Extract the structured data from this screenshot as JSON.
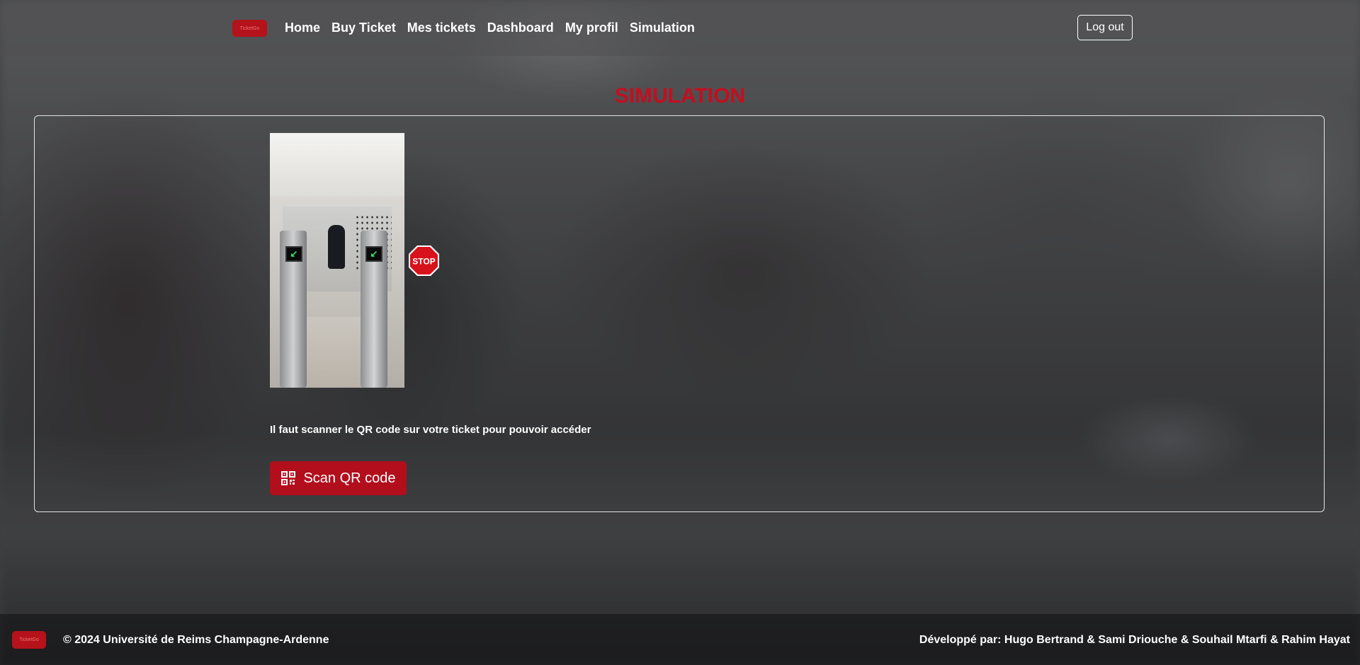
{
  "header": {
    "logo_text": "TicketGo",
    "nav": [
      {
        "label": "Home"
      },
      {
        "label": "Buy Ticket"
      },
      {
        "label": "Mes tickets"
      },
      {
        "label": "Dashboard"
      },
      {
        "label": "My profil"
      },
      {
        "label": "Simulation"
      }
    ],
    "logout_label": "Log out"
  },
  "main": {
    "title": "SIMULATION",
    "stop_sign_text": "STOP",
    "info_text": "Il faut scanner le QR code sur votre ticket pour pouvoir accéder",
    "scan_button_label": "Scan QR code",
    "scan_button_icon": "qr-code-icon"
  },
  "footer": {
    "logo_text": "TicketGo",
    "copyright": "© 2024 Université de Reims Champagne-Ardenne",
    "credits": "Développé par: Hugo Bertrand & Sami Driouche & Souhail Mtarfi & Rahim Hayat"
  },
  "colors": {
    "accent": "#b20e1c",
    "title": "#c40e1f"
  }
}
